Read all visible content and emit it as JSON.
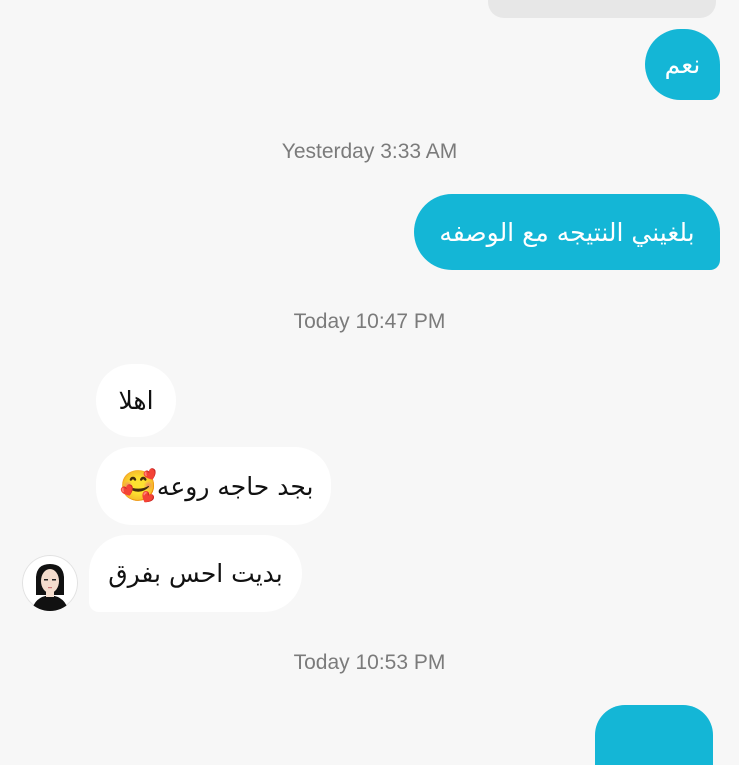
{
  "messages": {
    "top_partial": "",
    "out1": "نعم",
    "out2": "بلغيني النتيجه مع الوصفه",
    "in1": "اهلا",
    "in2": "بجد حاجه روعه",
    "in2_emoji": "🥰",
    "in3": "بديت احس بفرق",
    "bottom_partial": ""
  },
  "timestamps": {
    "t1": "Yesterday 3:33 AM",
    "t2": "Today 10:47 PM",
    "t3": "Today 10:53 PM"
  },
  "colors": {
    "outgoing": "#14b6d6",
    "incoming": "#ffffff",
    "background": "#f7f7f7",
    "timestamp": "#7b7b7b"
  },
  "icons": {
    "avatar": "user-avatar-icon"
  }
}
